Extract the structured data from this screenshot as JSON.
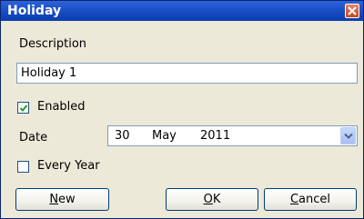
{
  "window": {
    "title": "Holiday"
  },
  "description": {
    "label": "Description",
    "value": "Holiday 1"
  },
  "enabled": {
    "label": "Enabled",
    "checked": true
  },
  "date": {
    "label": "Date",
    "day": "30",
    "month": "May",
    "year": "2011"
  },
  "every_year": {
    "label": "Every Year",
    "checked": false
  },
  "buttons": {
    "new": {
      "accel": "N",
      "rest": "ew"
    },
    "ok": {
      "accel": "O",
      "rest": "K"
    },
    "cancel": {
      "accel": "C",
      "rest": "ancel"
    }
  },
  "icons": {
    "close": "close-x-icon",
    "check": "checkmark-icon",
    "dropdown": "chevron-down-icon"
  }
}
